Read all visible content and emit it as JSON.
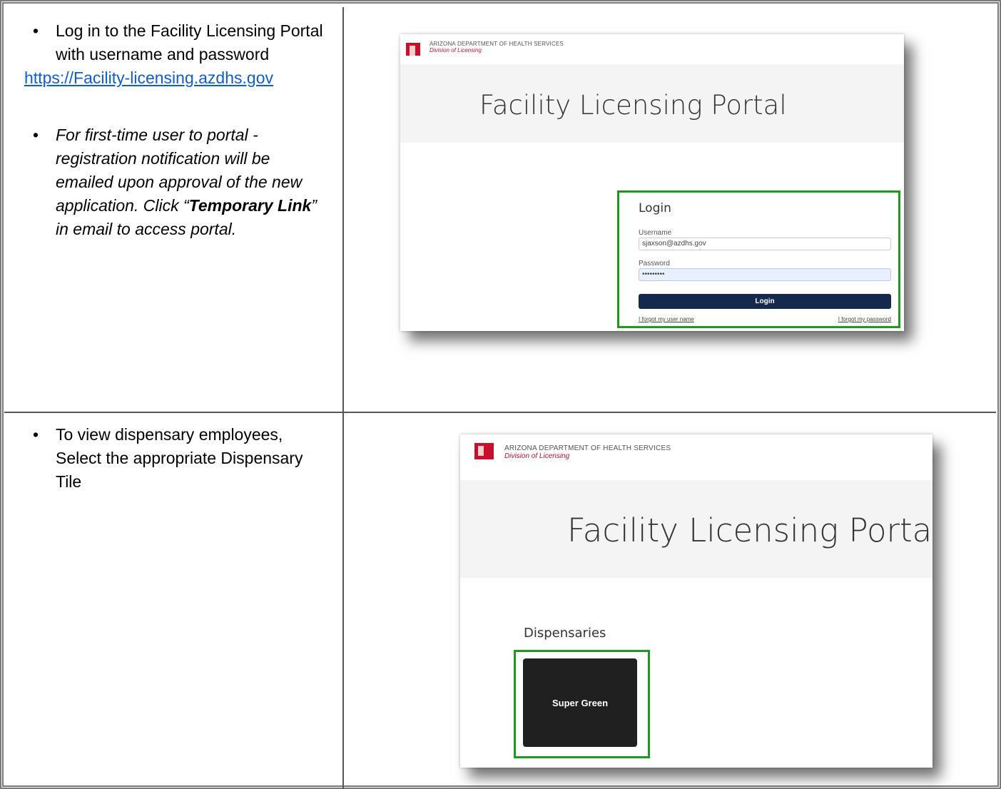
{
  "row1": {
    "step_text": "Log in to the Facility Licensing Portal with username and password",
    "url": "https://Facility-licensing.azdhs.gov",
    "note_part1": "For first-time user to portal - registration notification will be emailed upon approval of the new application.  Click “",
    "note_bold": "Temporary Link",
    "note_part2": "” in email to access portal."
  },
  "row2": {
    "step_text": "To view dispensary employees, Select the appropriate Dispensary Tile"
  },
  "bullet_glyph": "•",
  "portal": {
    "agency_line1": "ARIZONA DEPARTMENT OF HEALTH SERVICES",
    "agency_line2": "Division of Licensing",
    "title": "Facility Licensing Portal"
  },
  "login_form": {
    "heading": "Login",
    "username_label": "Username",
    "username_value": "sjaxson@azdhs.gov",
    "password_label": "Password",
    "password_value": "•••••••••",
    "button_label": "Login",
    "forgot_username": "I forgot my user name",
    "forgot_password": "I forgot my password"
  },
  "dispensaries": {
    "heading": "Dispensaries",
    "tile_label": "Super Green"
  },
  "colors": {
    "highlight_border": "#1e9b1e",
    "login_button": "#14294d",
    "logo_red": "#c8102e",
    "tile_bg": "#202020",
    "link": "#0b5fd0"
  }
}
